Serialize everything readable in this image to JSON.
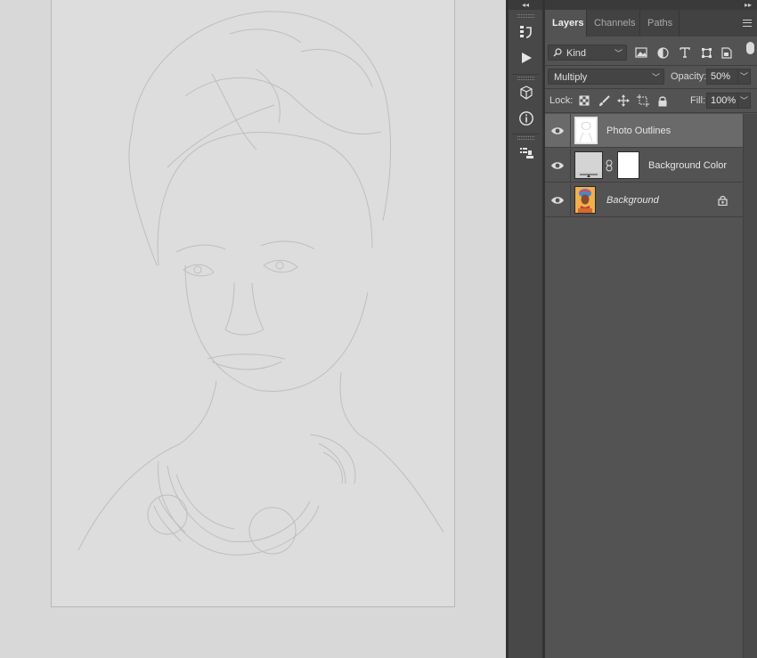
{
  "app": {
    "collapse_left": "◂◂",
    "collapse_right": "▸▸"
  },
  "layers_panel": {
    "tabs": [
      {
        "label": "Layers",
        "active": true
      },
      {
        "label": "Channels",
        "active": false
      },
      {
        "label": "Paths",
        "active": false
      }
    ],
    "filter": {
      "label": "Kind"
    },
    "filter_icons": [
      "image-filter-icon",
      "adjustment-filter-icon",
      "type-filter-icon",
      "shape-filter-icon",
      "smart-object-filter-icon"
    ],
    "blend_mode": "Multiply",
    "opacity_label": "Opacity:",
    "opacity_value": "50%",
    "lock_label": "Lock:",
    "lock_icons": [
      "lock-transparent-pixels-icon",
      "lock-image-pixels-icon",
      "lock-position-icon",
      "lock-artboard-icon",
      "lock-all-icon"
    ],
    "fill_label": "Fill:",
    "fill_value": "100%",
    "layers": [
      {
        "name": "Photo Outlines",
        "visible": true,
        "selected": true,
        "italic": false
      },
      {
        "name": "Background Color",
        "visible": true,
        "selected": false,
        "italic": false
      },
      {
        "name": "Background",
        "visible": true,
        "selected": false,
        "italic": true,
        "locked": true
      }
    ]
  },
  "tool_strip": {
    "icons": [
      "history-icon",
      "actions-play-icon",
      "3d-cube-icon",
      "info-icon",
      "properties-icon"
    ]
  },
  "colors": {
    "canvas_bg": "#d8d8d8",
    "panel_bg": "#535353",
    "selected_layer": "#6a6a6a"
  }
}
